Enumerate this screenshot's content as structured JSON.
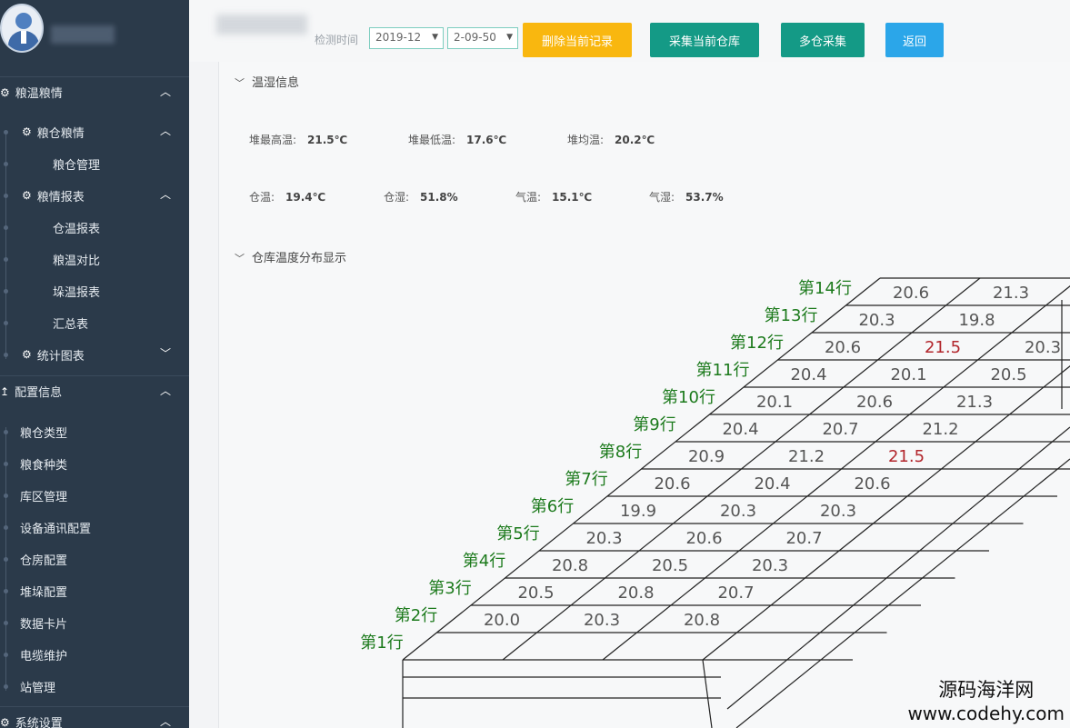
{
  "sidebar": {
    "groups": [
      {
        "label": "粮温粮情",
        "icon": "gear-icon",
        "chevron": "chevron-up-icon"
      },
      {
        "label": "粮仓粮情",
        "icon": "gear-icon",
        "chevron": "chevron-up-icon"
      },
      {
        "label": "粮仓管理"
      },
      {
        "label": "粮情报表",
        "icon": "gear-icon",
        "chevron": "chevron-up-icon"
      },
      {
        "label": "仓温报表"
      },
      {
        "label": "粮温对比"
      },
      {
        "label": "垛温报表"
      },
      {
        "label": "汇总表"
      },
      {
        "label": "统计图表",
        "icon": "gear-icon",
        "chevron": "chevron-down-icon"
      },
      {
        "label": "配置信息",
        "icon": "upload-icon",
        "chevron": "chevron-up-icon"
      },
      {
        "label": "粮仓类型"
      },
      {
        "label": "粮食种类"
      },
      {
        "label": "库区管理"
      },
      {
        "label": "设备通讯配置"
      },
      {
        "label": "仓房配置"
      },
      {
        "label": "堆垛配置"
      },
      {
        "label": "数据卡片"
      },
      {
        "label": "电缆维护"
      },
      {
        "label": "站管理"
      },
      {
        "label": "系统设置",
        "icon": "gear-icon",
        "chevron": "chevron-up-icon"
      }
    ]
  },
  "toolbar": {
    "time_label": "检测时间",
    "date_value": "2019-12",
    "time_value": "2-09-50",
    "delete_label": "删除当前记录",
    "collect_label": "采集当前仓库",
    "multi_label": "多仓采集",
    "back_label": "返回",
    "colors": {
      "delete": "#f9b70f",
      "collect": "#149a86",
      "back": "#2ba6e9"
    }
  },
  "humidity": {
    "title": "温湿信息",
    "max_label": "堆最高温:",
    "max_value": "21.5℃",
    "min_label": "堆最低温:",
    "min_value": "17.6℃",
    "avg_label": "堆均温:",
    "avg_value": "20.2℃",
    "wt_label": "仓温:",
    "wt_value": "19.4℃",
    "wh_label": "仓湿:",
    "wh_value": "51.8%",
    "at_label": "气温:",
    "at_value": "15.1℃",
    "ah_label": "气湿:",
    "ah_value": "53.7%"
  },
  "distribution": {
    "title": "仓库温度分布显示",
    "highlight_color": "#b2262c",
    "label_color": "#1c7a1c",
    "rows": [
      {
        "label": "第1行",
        "values": []
      },
      {
        "label": "第2行",
        "values": [
          "20.0",
          "20.3",
          "20.8"
        ]
      },
      {
        "label": "第3行",
        "values": [
          "20.5",
          "20.8",
          "20.7"
        ]
      },
      {
        "label": "第4行",
        "values": [
          "20.8",
          "20.5",
          "20.3"
        ]
      },
      {
        "label": "第5行",
        "values": [
          "20.3",
          "20.6",
          "20.7"
        ]
      },
      {
        "label": "第6行",
        "values": [
          "19.9",
          "20.3",
          "20.3"
        ]
      },
      {
        "label": "第7行",
        "values": [
          "20.6",
          "20.4",
          "20.6"
        ]
      },
      {
        "label": "第8行",
        "values": [
          "20.9",
          "21.2",
          "21.5"
        ]
      },
      {
        "label": "第9行",
        "values": [
          "20.4",
          "20.7",
          "21.2"
        ]
      },
      {
        "label": "第10行",
        "values": [
          "20.1",
          "20.6",
          "21.3"
        ]
      },
      {
        "label": "第11行",
        "values": [
          "20.4",
          "20.1",
          "20.5"
        ]
      },
      {
        "label": "第12行",
        "values": [
          "20.6",
          "21.5",
          "20.3"
        ]
      },
      {
        "label": "第13行",
        "values": [
          "20.3",
          "19.8",
          "2"
        ]
      },
      {
        "label": "第14行",
        "values": [
          "20.6",
          "21.3"
        ]
      }
    ],
    "highlight_values": [
      "21.5"
    ]
  },
  "watermark": {
    "cn": "源码海洋网",
    "url": "www.codehy.com"
  }
}
